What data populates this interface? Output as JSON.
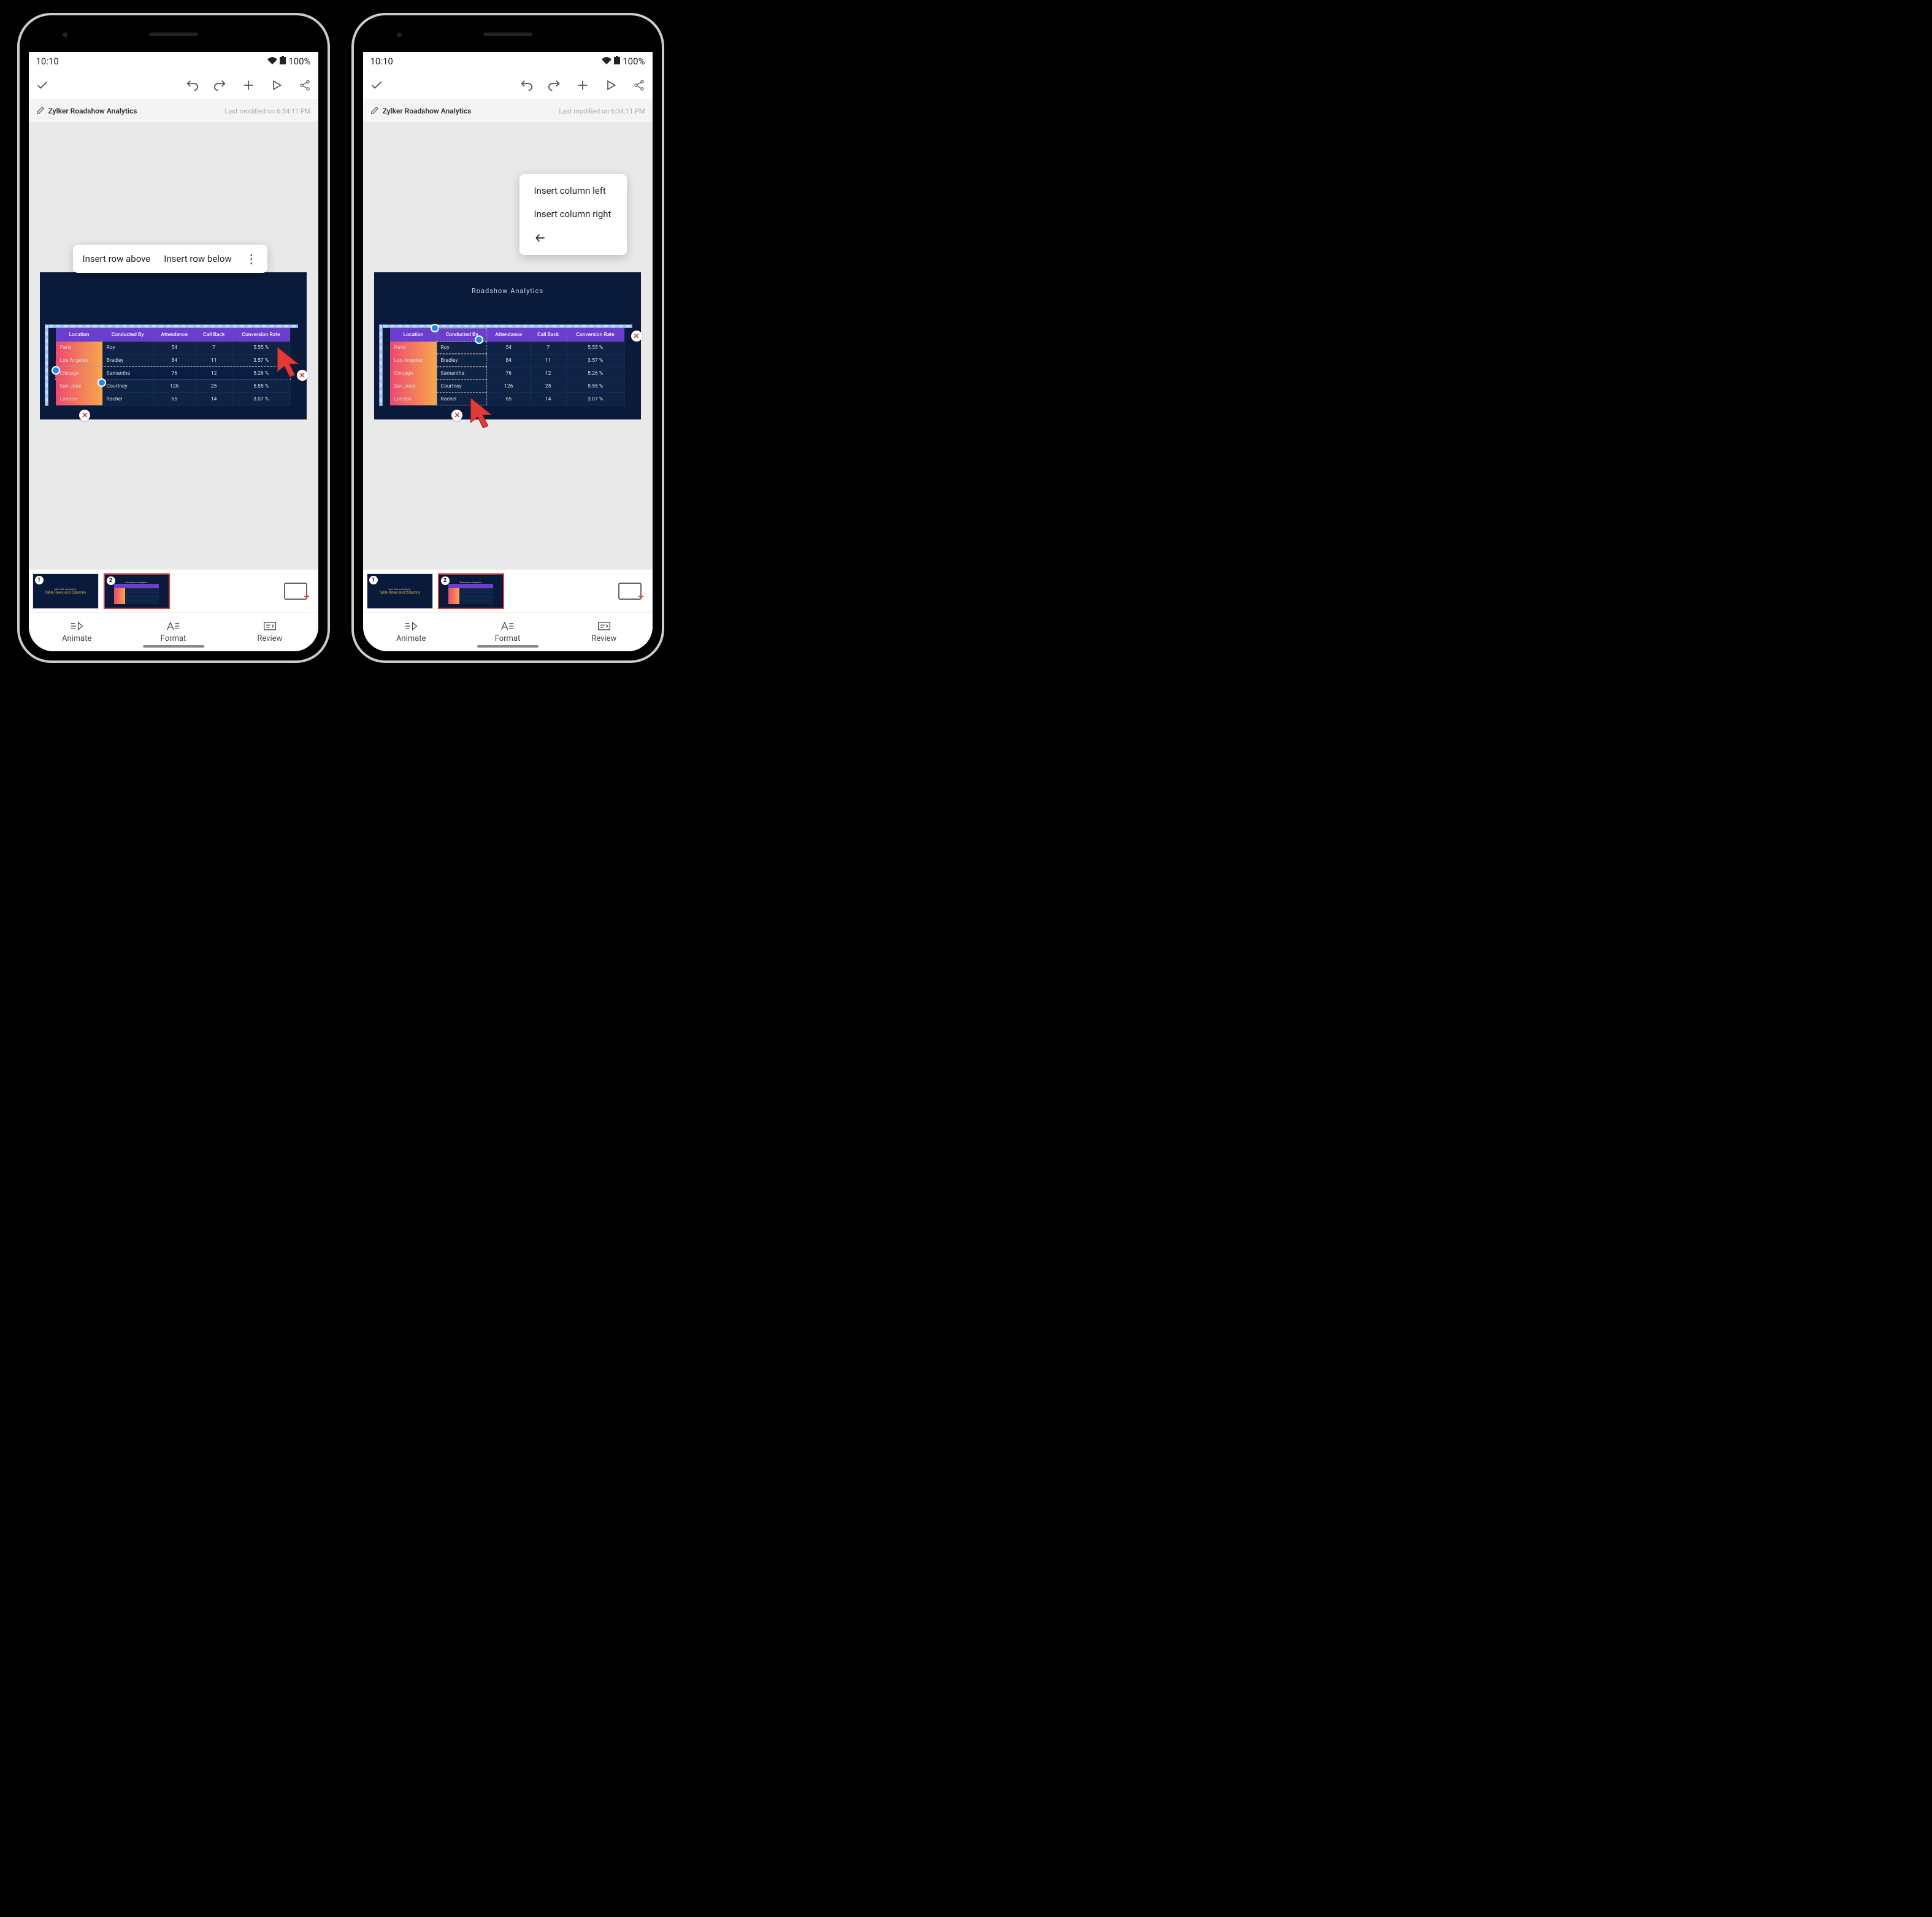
{
  "status": {
    "time": "10:10",
    "battery": "100%"
  },
  "doc": {
    "title": "Zylker Roadshow Analytics",
    "modified": "Last modified on 6:34:11 PM"
  },
  "slide": {
    "title": "Roadshow Analytics"
  },
  "table": {
    "headers": [
      "Location",
      "Conducted By",
      "Attendance",
      "Call Back",
      "Conversion Rate"
    ],
    "rows": [
      [
        "Paris",
        "Roy",
        "54",
        "7",
        "5.55 %"
      ],
      [
        "Los Angeles",
        "Bradley",
        "84",
        "11",
        "3.57 %"
      ],
      [
        "Chicago",
        "Samantha",
        "76",
        "12",
        "5.26 %"
      ],
      [
        "San Jose",
        "Courtney",
        "126",
        "25",
        "5.55 %"
      ],
      [
        "London",
        "Rachel",
        "65",
        "14",
        "3.07 %"
      ]
    ]
  },
  "menu_row": {
    "above": "Insert row above",
    "below": "Insert row below"
  },
  "menu_col": {
    "left": "Insert column left",
    "right": "Insert column right"
  },
  "thumbs": {
    "t1_sub": "Add, Edit, and Delete",
    "t1_title": "Table Rows and Columns",
    "t2_title": "Roadshow Analytics"
  },
  "tabs": {
    "animate": "Animate",
    "format": "Format",
    "review": "Review"
  }
}
